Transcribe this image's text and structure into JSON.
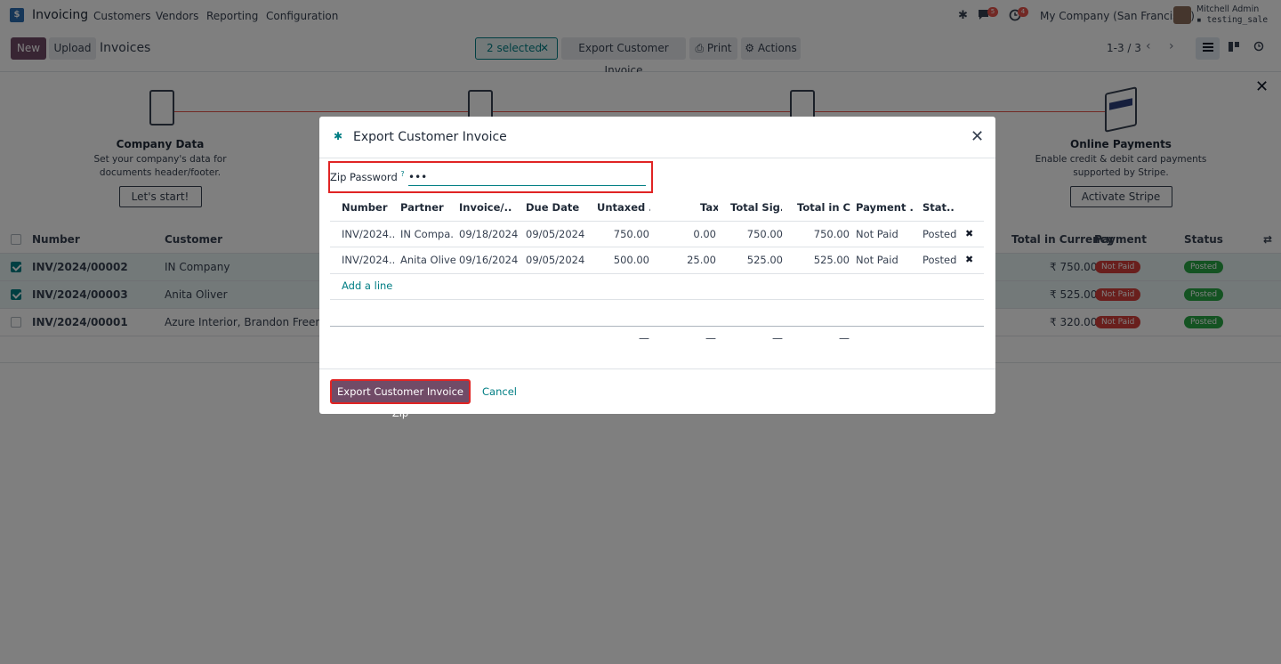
{
  "navbar": {
    "app_name": "Invoicing",
    "menu": [
      "Customers",
      "Vendors",
      "Reporting",
      "Configuration"
    ],
    "chat_count": "5",
    "activity_count": "4",
    "company": "My Company (San Francisco)",
    "user": "Mitchell Admin",
    "db": "testing_sale",
    "icons": [
      "bug-icon",
      "chat-icon",
      "clock-icon"
    ]
  },
  "control_panel": {
    "new_label": "New",
    "upload_label": "Upload",
    "title": "Invoices",
    "selected_label": "2 selected",
    "export_label": "Export Customer Invoice",
    "print_label": "Print",
    "actions_label": "Actions",
    "pager": "1-3 / 3"
  },
  "banner": {
    "steps": [
      {
        "title": "Company Data",
        "desc": "Set your company's data for documents header/footer.",
        "button": "Let's start!"
      },
      {
        "title": "Online Payments",
        "desc": "Enable credit & debit card payments supported by Stripe.",
        "button": "Activate Stripe"
      }
    ]
  },
  "list": {
    "headers": {
      "number": "Number",
      "customer": "Customer",
      "total_currency": "Total in Currency",
      "payment": "Payment",
      "status": "Status"
    },
    "rows": [
      {
        "number": "INV/2024/00002",
        "customer": "IN Company",
        "total": "₹ 750.00",
        "payment": "Not Paid",
        "status": "Posted",
        "selected": true
      },
      {
        "number": "INV/2024/00003",
        "customer": "Anita Oliver",
        "total": "₹ 525.00",
        "payment": "Not Paid",
        "status": "Posted",
        "selected": true
      },
      {
        "number": "INV/2024/00001",
        "customer": "Azure Interior, Brandon Freeman",
        "total": "₹ 320.00",
        "payment": "Not Paid",
        "status": "Posted",
        "selected": false
      }
    ]
  },
  "modal": {
    "title": "Export Customer Invoice",
    "zip_password_label": "Zip Password",
    "zip_password_help": "?",
    "zip_password_value": "•••",
    "columns": [
      "Number",
      "Partner",
      "Invoice/...",
      "Due Date",
      "Untaxed ...",
      "Tax",
      "Total Sig...",
      "Total in C...",
      "Payment ...",
      "Stat..."
    ],
    "rows": [
      {
        "number": "INV/2024...",
        "partner": "IN Compa...",
        "invoice_date": "09/18/2024",
        "due_date": "09/05/2024",
        "untaxed": "750.00",
        "tax": "0.00",
        "total_signed": "750.00",
        "total_currency": "750.00",
        "payment": "Not Paid",
        "status": "Posted"
      },
      {
        "number": "INV/2024...",
        "partner": "Anita Oliver",
        "invoice_date": "09/16/2024",
        "due_date": "09/05/2024",
        "untaxed": "500.00",
        "tax": "25.00",
        "total_signed": "525.00",
        "total_currency": "525.00",
        "payment": "Not Paid",
        "status": "Posted"
      }
    ],
    "add_line": "Add a line",
    "totals": [
      "—",
      "—",
      "—",
      "—"
    ],
    "export_zip_label": "Export Customer Invoice Zip",
    "cancel_label": "Cancel"
  },
  "colors": {
    "brand": "#714b67",
    "accent": "#017e84",
    "danger": "#d23f3a",
    "success": "#28a745",
    "highlight_border": "#e02424"
  }
}
